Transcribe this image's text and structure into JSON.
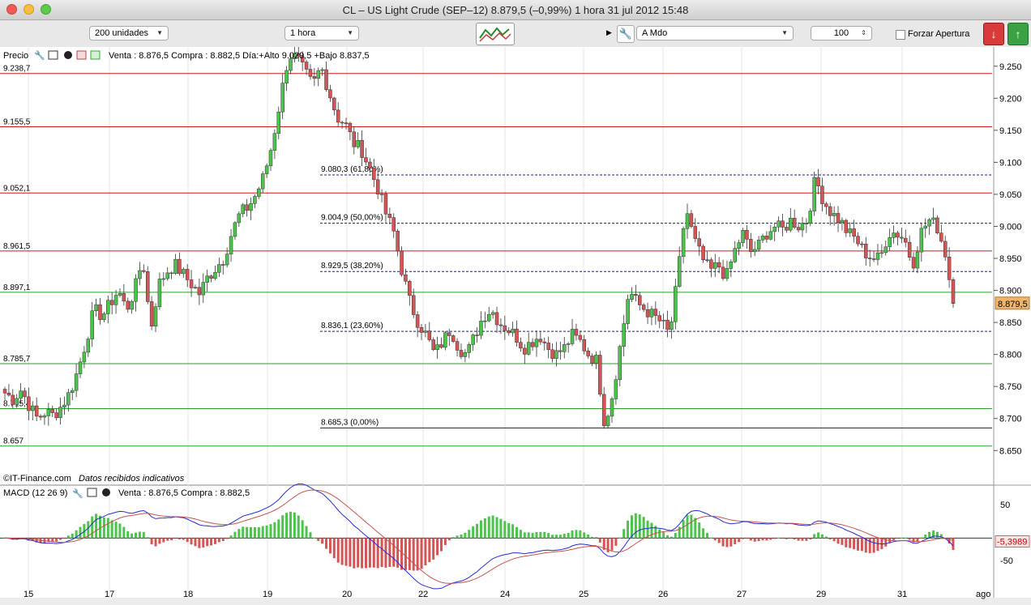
{
  "window": {
    "title": "CL – US Light Crude (SEP–12)    8.879,5 (–0,99%)    1 hora  31 jul 2012 15:48"
  },
  "toolbar": {
    "units": "200 unidades",
    "period": "1 hora",
    "market_type": "A Mdo",
    "quantity": "100",
    "force_open_label": "Forzar Apertura"
  },
  "price_panel": {
    "label": "Precio",
    "quote": "Venta : 8.876,5 Compra : 8.882,5 Día:+Alto 9.029,5 +Bajo 8.837,5",
    "source": "©IT-Finance.com",
    "disclaimer": "Datos recibidos indicativos",
    "last_price_label": "8.879,5"
  },
  "macd_panel": {
    "label": "MACD (12 26 9)",
    "quote": "Venta : 8.876,5 Compra : 8.882,5",
    "value_label": "-5,3989",
    "axis_ticks": [
      "50",
      "-50"
    ]
  },
  "colors": {
    "up": "#4cc44c",
    "down": "#d45555",
    "resistance": "#d01818",
    "support": "#2aa02a",
    "fib": "#1a1a8c"
  },
  "chart_data": {
    "type": "candlestick",
    "title": "CL – US Light Crude (SEP–12)",
    "timeframe": "1 hora",
    "ylim": [
      8620,
      9275
    ],
    "y_ticks": [
      8650,
      8700,
      8750,
      8800,
      8850,
      8900,
      8950,
      9000,
      9050,
      9100,
      9150,
      9200,
      9250
    ],
    "y_tick_labels": [
      "8.650",
      "8.700",
      "8.750",
      "8.800",
      "8.850",
      "8.900",
      "8.950",
      "9.000",
      "9.050",
      "9.100",
      "9.150",
      "9.200",
      "9.250"
    ],
    "x_labels": [
      "15",
      "17",
      "18",
      "19",
      "20",
      "22",
      "24",
      "25",
      "26",
      "27",
      "29",
      "31",
      "ago"
    ],
    "close_path": [
      8740,
      8730,
      8745,
      8720,
      8700,
      8710,
      8705,
      8720,
      8740,
      8775,
      8820,
      8870,
      8860,
      8880,
      8900,
      8870,
      8900,
      8950,
      8840,
      8910,
      8930,
      8940,
      8925,
      8910,
      8895,
      8920,
      8935,
      8950,
      8990,
      9020,
      9030,
      9050,
      9080,
      9130,
      9200,
      9268,
      9262,
      9240,
      9220,
      9250,
      9210,
      9170,
      9160,
      9130,
      9120,
      9090,
      9060,
      9020,
      8990,
      8930,
      8880,
      8850,
      8830,
      8800,
      8820,
      8840,
      8810,
      8800,
      8830,
      8860,
      8870,
      8850,
      8840,
      8830,
      8810,
      8820,
      8830,
      8810,
      8800,
      8810,
      8830,
      8820,
      8800,
      8790,
      8690,
      8740,
      8820,
      8900,
      8880,
      8870,
      8860,
      8850,
      8830,
      8920,
      9030,
      8980,
      8950,
      8930,
      8940,
      8920,
      8960,
      8990,
      8960,
      8970,
      8990,
      9000,
      8995,
      9010,
      9000,
      9010,
      9075,
      9040,
      9020,
      9010,
      8990,
      8980,
      8960,
      8950,
      8950,
      8990,
      8990,
      8980,
      8940,
      8990,
      9010,
      9000,
      8960,
      8880
    ],
    "levels": {
      "resistance": [
        9238.7,
        9155.5,
        9052.1,
        8961.5
      ],
      "support": [
        8897.1,
        8785.7,
        8715.4,
        8657
      ],
      "resistance_labels": [
        "9.238,7",
        "9.155,5",
        "9.052,1",
        "8.961,5"
      ],
      "support_labels": [
        "8.897,1",
        "8.785,7",
        "8.715,4",
        "8.657"
      ]
    },
    "fibonacci": [
      {
        "value": 9080.3,
        "label": "9.080,3 (61,80%)"
      },
      {
        "value": 9004.9,
        "label": "9.004,9 (50,00%)"
      },
      {
        "value": 8929.5,
        "label": "8.929,5 (38,20%)"
      },
      {
        "value": 8836.1,
        "label": "8.836,1 (23,60%)"
      },
      {
        "value": 8685.3,
        "label": "8.685,3 (0,00%)"
      }
    ],
    "last_price": 8879.5,
    "macd": {
      "name": "MACD (12 26 9)",
      "last": -5.3989,
      "ylim": [
        -85,
        60
      ]
    }
  }
}
